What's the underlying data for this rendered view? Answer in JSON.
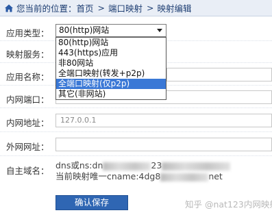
{
  "breadcrumb": {
    "prefix": "您当前的位置：",
    "items": [
      "首页",
      "端口映射",
      "映射编辑"
    ],
    "separator": ">"
  },
  "form": {
    "app_type": {
      "label": "应用类型：",
      "value": "80(http)网站",
      "options": [
        "80(http)网站",
        "443(https)应用",
        "非80网站",
        "全端口映射(转发+p2p)",
        "全端口映射(仅p2p)",
        "其它(非网站)"
      ],
      "highlighted_index": 4
    },
    "mapping_service": {
      "label": "映射服务："
    },
    "app_name": {
      "label": "应用名称："
    },
    "lan_port": {
      "label": "内网端口："
    },
    "lan_address": {
      "label": "内网地址：",
      "value": "127.0.0.1"
    },
    "wan_address": {
      "label": "外网网址："
    },
    "own_domain": {
      "label": "自主域名：",
      "line1_visible_prefix": "dns或ns:dn",
      "line1_visible_mid": "23",
      "line2_visible_prefix": "当前映射唯一cname:4dg8",
      "line2_visible_suffix": "net"
    },
    "save_label": "确认保存"
  },
  "watermark": "知乎 @nat123内网映射",
  "colors": {
    "breadcrumb_bg": "#e9eef6",
    "accent_blue": "#2f66b3",
    "option_highlight": "#3a78d6"
  }
}
